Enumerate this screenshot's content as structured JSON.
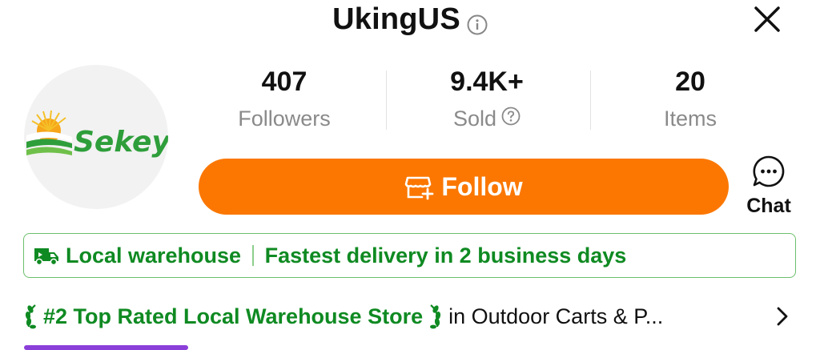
{
  "header": {
    "store_name": "UkingUS"
  },
  "avatar": {
    "logo_text": "Sekey"
  },
  "stats": [
    {
      "value": "407",
      "label": "Followers"
    },
    {
      "value": "9.4K+",
      "label": "Sold"
    },
    {
      "value": "20",
      "label": "Items"
    }
  ],
  "follow_button": {
    "label": "Follow"
  },
  "chat": {
    "label": "Chat"
  },
  "warehouse": {
    "label": "Local warehouse",
    "delivery": "Fastest delivery in 2 business days"
  },
  "rank": {
    "badge": "#2 Top Rated Local Warehouse Store",
    "category": "in Outdoor Carts & P..."
  },
  "colors": {
    "accent": "#fb7701",
    "green": "#0f8a22"
  }
}
